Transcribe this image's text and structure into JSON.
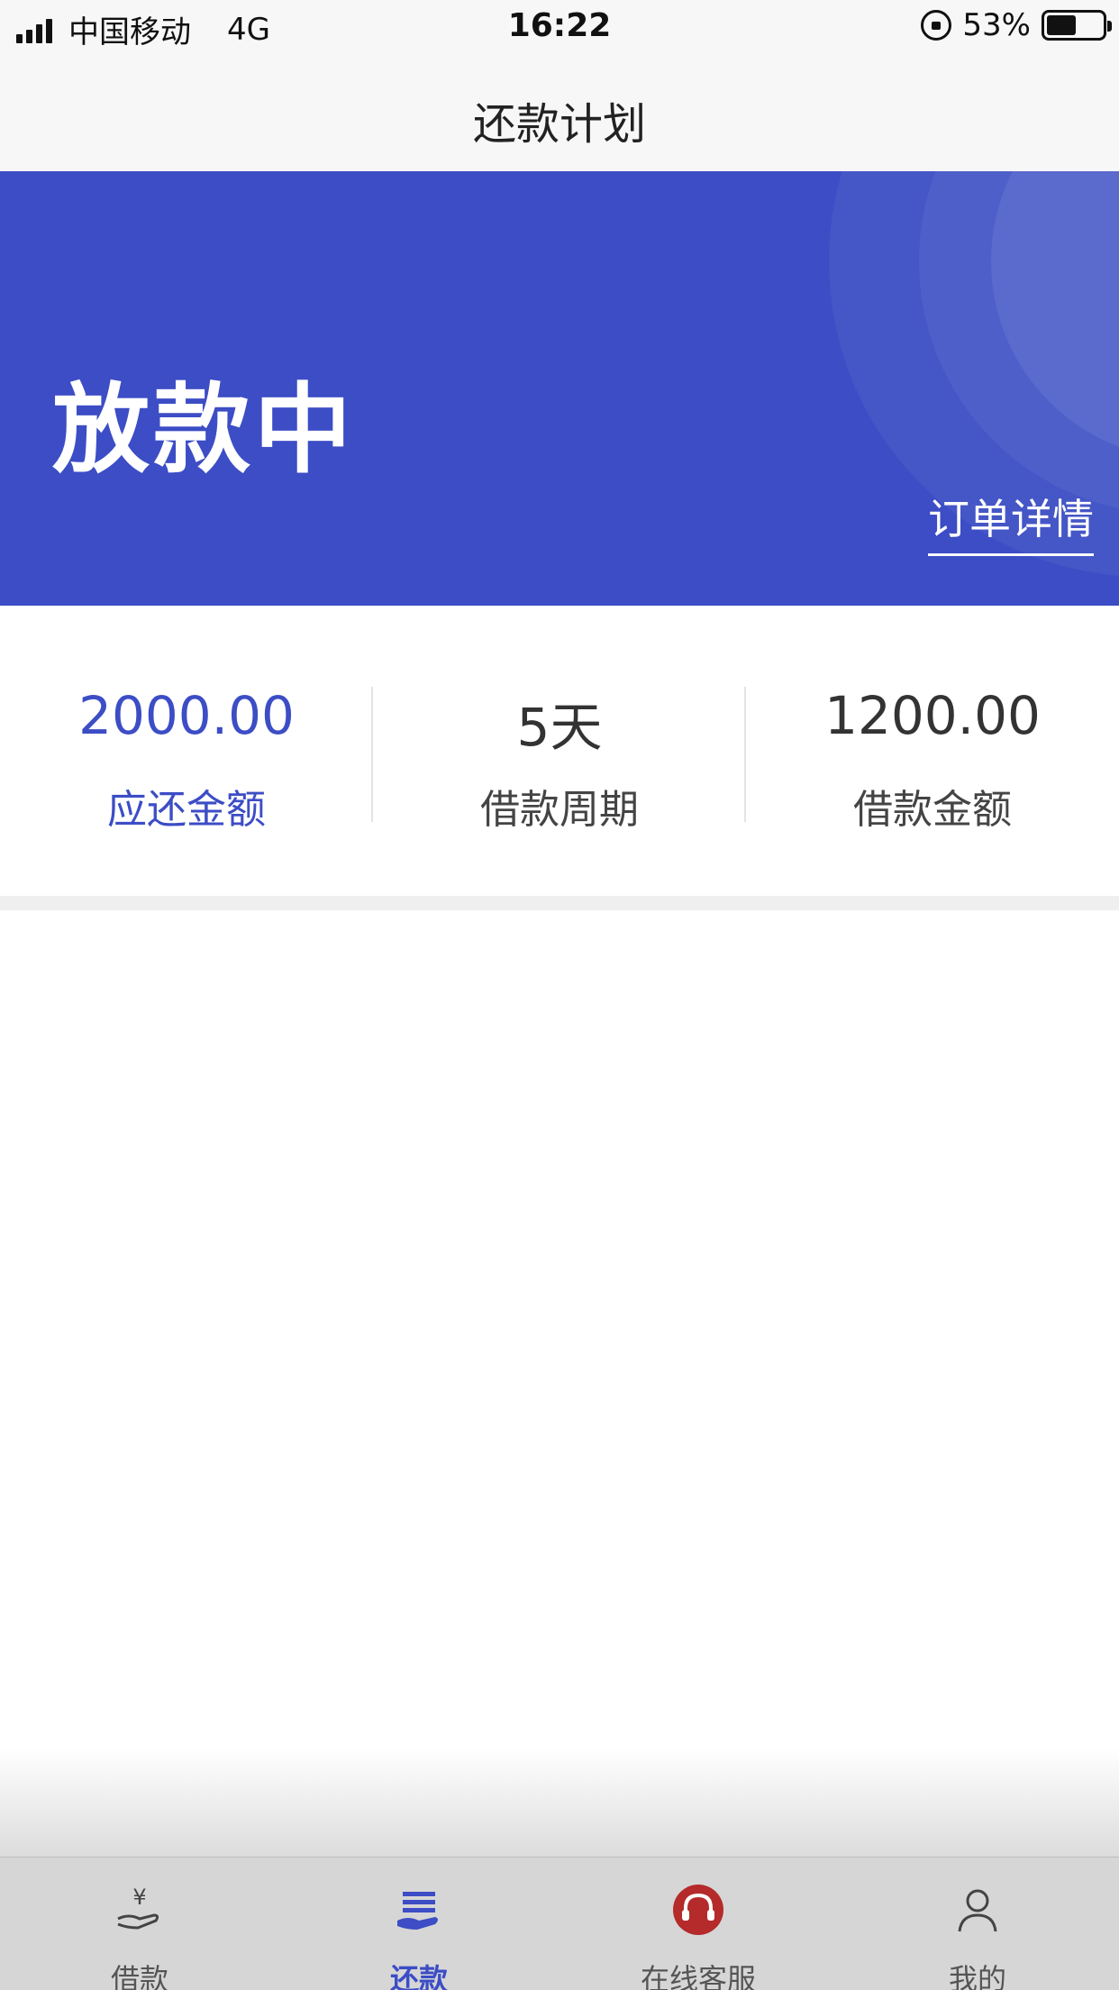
{
  "status_bar": {
    "carrier": "中国移动",
    "network": "4G",
    "time": "16:22",
    "battery": "53%",
    "battery_level": 0.53
  },
  "nav": {
    "title": "还款计划"
  },
  "banner": {
    "status": "放款中",
    "order_details_link": "订单详情",
    "color": "#3c4dc5"
  },
  "stats": [
    {
      "value": "2000.00",
      "label": "应还金额"
    },
    {
      "value": "5天",
      "label": "借款周期"
    },
    {
      "value": "1200.00",
      "label": "借款金额"
    }
  ],
  "tabs": [
    {
      "label": "借款",
      "icon": "hand-yen-icon"
    },
    {
      "label": "还款",
      "icon": "stack-hand-icon",
      "active": true
    },
    {
      "label": "在线客服",
      "icon": "headset-icon"
    },
    {
      "label": "我的",
      "icon": "user-icon"
    }
  ]
}
